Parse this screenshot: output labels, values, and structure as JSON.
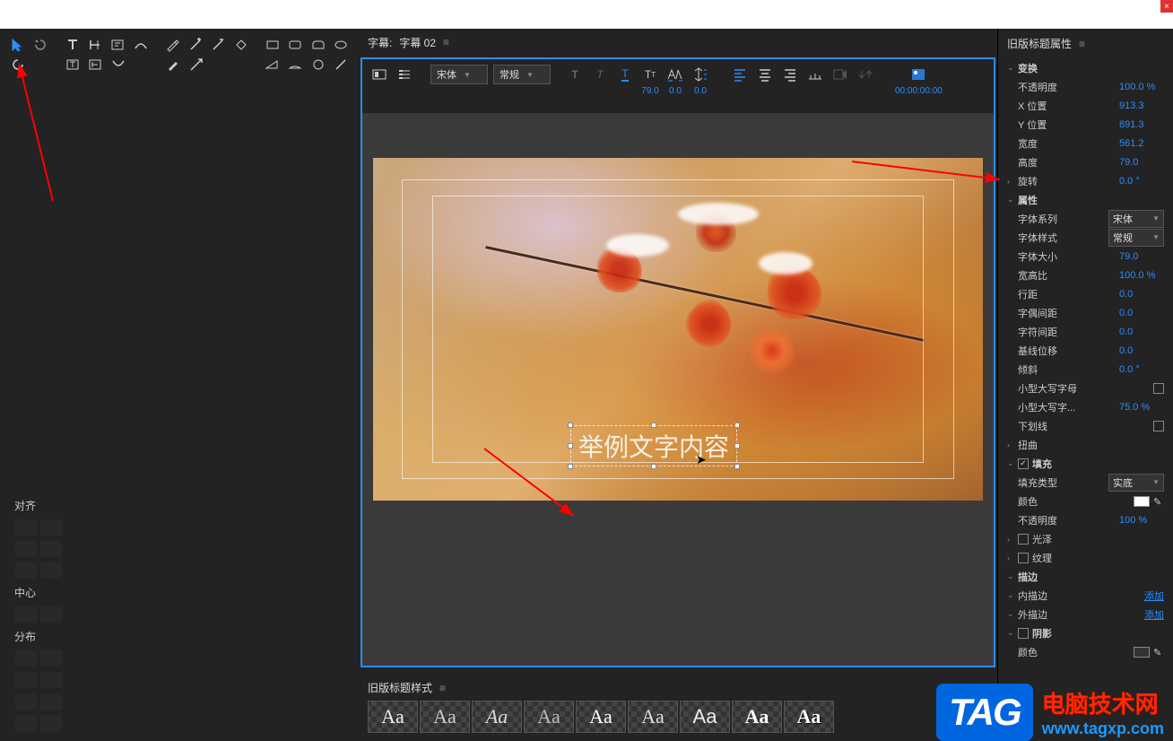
{
  "titleTab": {
    "prefix": "字幕:",
    "name": "字幕 02",
    "menu": "≡"
  },
  "formatBar": {
    "font": "宋体",
    "weight": "常规",
    "size": "79.0",
    "kerning": "0.0",
    "leading": "0.0",
    "timecode": "00:00:00:00"
  },
  "canvasText": "举例文字内容",
  "leftPanels": {
    "align": "对齐",
    "center": "中心",
    "distribute": "分布"
  },
  "stylesPanel": {
    "title": "旧版标题样式",
    "swatch": "Aa"
  },
  "propsPanel": {
    "title": "旧版标题属性",
    "transform": {
      "head": "变换",
      "opacity": {
        "label": "不透明度",
        "value": "100.0 %"
      },
      "xpos": {
        "label": "X 位置",
        "value": "913.3"
      },
      "ypos": {
        "label": "Y 位置",
        "value": "891.3"
      },
      "width": {
        "label": "宽度",
        "value": "561.2"
      },
      "height": {
        "label": "高度",
        "value": "79.0"
      },
      "rotation": {
        "label": "旋转",
        "value": "0.0 °"
      }
    },
    "attributes": {
      "head": "属性",
      "fontFamily": {
        "label": "字体系列",
        "value": "宋体"
      },
      "fontStyle": {
        "label": "字体样式",
        "value": "常规"
      },
      "fontSize": {
        "label": "字体大小",
        "value": "79.0"
      },
      "aspect": {
        "label": "宽高比",
        "value": "100.0 %"
      },
      "lineSpacing": {
        "label": "行距",
        "value": "0.0"
      },
      "kerning": {
        "label": "字偶间距",
        "value": "0.0"
      },
      "tracking": {
        "label": "字符间距",
        "value": "0.0"
      },
      "baseline": {
        "label": "基线位移",
        "value": "0.0"
      },
      "slant": {
        "label": "倾斜",
        "value": "0.0 °"
      },
      "smallCaps": {
        "label": "小型大写字母"
      },
      "smallCapsSize": {
        "label": "小型大写字...",
        "value": "75.0 %"
      },
      "underline": {
        "label": "下划线"
      },
      "distort": {
        "label": "扭曲"
      }
    },
    "fill": {
      "head": "填充",
      "type": {
        "label": "填充类型",
        "value": "实底"
      },
      "color": {
        "label": "颜色"
      },
      "opacity": {
        "label": "不透明度",
        "value": "100 %"
      },
      "sheen": {
        "label": "光泽"
      },
      "texture": {
        "label": "纹理"
      }
    },
    "stroke": {
      "head": "描边",
      "inner": {
        "label": "内描边",
        "add": "添加"
      },
      "outer": {
        "label": "外描边",
        "add": "添加"
      }
    },
    "shadow": {
      "head": "阴影",
      "color": {
        "label": "颜色"
      }
    }
  },
  "watermark": {
    "tag": "TAG",
    "line1": "电脑技术网",
    "line2": "www.tagxp.com"
  }
}
